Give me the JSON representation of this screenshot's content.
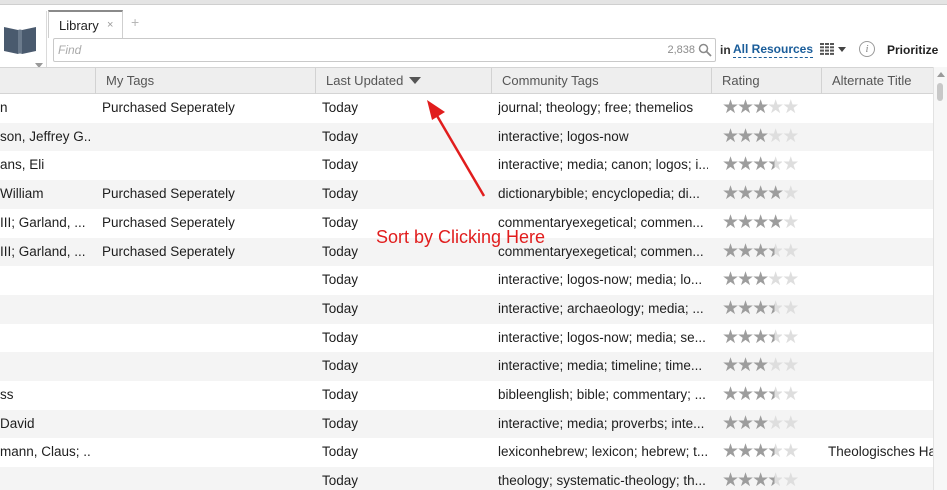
{
  "tab": {
    "label": "Library",
    "close": "×",
    "add": "+"
  },
  "search": {
    "placeholder": "Find",
    "count": "2,838"
  },
  "scope": {
    "prefix": "in",
    "value": "All Resources"
  },
  "toolbar": {
    "info": "i",
    "prioritize": "Prioritize"
  },
  "icons": {
    "library": "open-book-icon",
    "library_menu": "chevron-down-icon",
    "search": "magnifier-icon",
    "view": "grid-view-icon",
    "info": "info-icon"
  },
  "columns": {
    "my_tags": "My Tags",
    "last_updated": "Last Updated",
    "community_tags": "Community Tags",
    "rating": "Rating",
    "alternate_title": "Alternate Title"
  },
  "sort": {
    "column": "Last Updated",
    "direction": "descending"
  },
  "rows": [
    {
      "author": "n",
      "my_tags": "Purchased Seperately",
      "updated": "Today",
      "community": "journal; theology; free; themelios",
      "rating": 3,
      "alt_title": ""
    },
    {
      "author": "son, Jeffrey G...",
      "my_tags": "",
      "updated": "Today",
      "community": "interactive; logos-now",
      "rating": 3,
      "alt_title": ""
    },
    {
      "author": "ans, Eli",
      "my_tags": "",
      "updated": "Today",
      "community": "interactive; media; canon; logos; i...",
      "rating": 3.5,
      "alt_title": ""
    },
    {
      "author": "William",
      "my_tags": "Purchased Seperately",
      "updated": "Today",
      "community": "dictionarybible; encyclopedia; di...",
      "rating": 4,
      "alt_title": ""
    },
    {
      "author": "III; Garland, ...",
      "my_tags": "Purchased Seperately",
      "updated": "Today",
      "community": "commentaryexegetical; commen...",
      "rating": 4,
      "alt_title": ""
    },
    {
      "author": "III; Garland, ...",
      "my_tags": "Purchased Seperately",
      "updated": "Today",
      "community": "commentaryexegetical; commen...",
      "rating": 3.5,
      "alt_title": ""
    },
    {
      "author": "",
      "my_tags": "",
      "updated": "Today",
      "community": "interactive; logos-now; media; lo...",
      "rating": 3,
      "alt_title": ""
    },
    {
      "author": "",
      "my_tags": "",
      "updated": "Today",
      "community": "interactive; archaeology; media; ...",
      "rating": 3.5,
      "alt_title": ""
    },
    {
      "author": "",
      "my_tags": "",
      "updated": "Today",
      "community": "interactive; logos-now; media; se...",
      "rating": 3.5,
      "alt_title": ""
    },
    {
      "author": "",
      "my_tags": "",
      "updated": "Today",
      "community": "interactive; media; timeline; time...",
      "rating": 3,
      "alt_title": ""
    },
    {
      "author": "ss",
      "my_tags": "",
      "updated": "Today",
      "community": "bibleenglish; bible; commentary; ...",
      "rating": 3.5,
      "alt_title": ""
    },
    {
      "author": "David",
      "my_tags": "",
      "updated": "Today",
      "community": "interactive; media; proverbs; inte...",
      "rating": 3,
      "alt_title": ""
    },
    {
      "author": "mann, Claus; ...",
      "my_tags": "",
      "updated": "Today",
      "community": "lexiconhebrew; lexicon; hebrew; t...",
      "rating": 3.5,
      "alt_title": "Theologisches Ha"
    },
    {
      "author": "",
      "my_tags": "",
      "updated": "Today",
      "community": "theology; systematic-theology; th...",
      "rating": 3.5,
      "alt_title": ""
    }
  ],
  "annotation": {
    "text": "Sort by Clicking Here",
    "color": "#e11d1d"
  },
  "colors": {
    "header_bg": "#eeeeee",
    "alt_row": "#f4f4f4",
    "link": "#1a5d9a",
    "star": "#9d9d9d",
    "star_empty": "#dedede"
  }
}
